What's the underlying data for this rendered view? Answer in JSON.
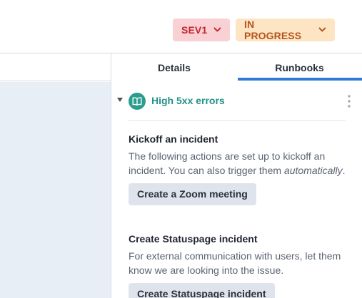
{
  "header": {
    "severity": {
      "label": "SEV1",
      "color": "#c0262d",
      "bg": "#f9d1d4"
    },
    "status": {
      "label": "IN PROGRESS",
      "color": "#b4531c",
      "bg": "#fde5c4"
    }
  },
  "tabs": [
    {
      "label": "Details",
      "active": false
    },
    {
      "label": "Runbooks",
      "active": true
    }
  ],
  "runbook": {
    "title": "High 5xx errors",
    "icon": "book-icon",
    "sections": [
      {
        "title": "Kickoff an incident",
        "description": "The following actions are set up to kickoff an incident. You can also trigger them",
        "description_emphasis": "automatically",
        "description_suffix": ".",
        "button": "Create a Zoom meeting"
      },
      {
        "title": "Create Statuspage incident",
        "description": "For external communication with users, let them know we are looking into the issue.",
        "button": "Create Statuspage incident"
      }
    ]
  }
}
